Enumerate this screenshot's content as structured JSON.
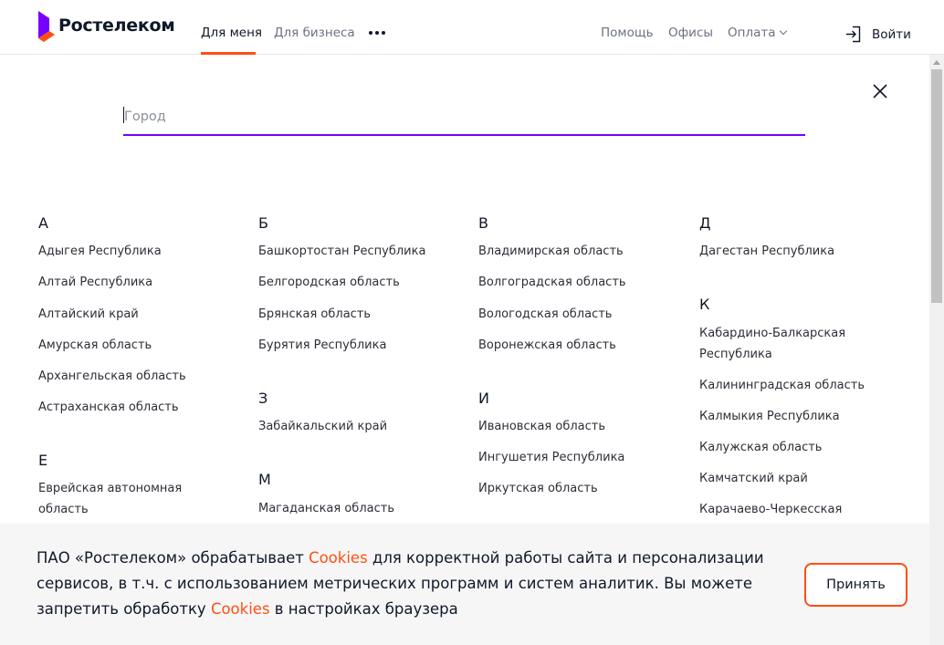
{
  "header": {
    "logo_text": "Ростелеком",
    "nav": [
      "Для меня",
      "Для бизнеса"
    ],
    "right_nav": [
      "Помощь",
      "Офисы",
      "Оплата"
    ],
    "login_label": "Войти",
    "accent": "#ff4f12",
    "logo_colors": [
      "#7700ff",
      "#ff4f12"
    ]
  },
  "search": {
    "placeholder": "Город",
    "value": ""
  },
  "regions": {
    "col1": {
      "A": {
        "letter": "А",
        "items": [
          "Адыгея Республика",
          "Алтай Республика",
          "Алтайский край",
          "Амурская область",
          "Архангельская область",
          "Астраханская область"
        ]
      },
      "E": {
        "letter": "Е",
        "items": [
          "Еврейская автономная",
          "область"
        ]
      }
    },
    "col2": {
      "B": {
        "letter": "Б",
        "items": [
          "Башкортостан Республика",
          "Белгородская область",
          "Брянская область",
          "Бурятия Республика"
        ]
      },
      "Z": {
        "letter": "З",
        "items": [
          "Забайкальский край"
        ]
      },
      "M": {
        "letter": "М",
        "items": [
          "Магаданская область"
        ]
      }
    },
    "col3": {
      "V": {
        "letter": "В",
        "items": [
          "Владимирская область",
          "Волгоградская область",
          "Вологодская область",
          "Воронежская область"
        ]
      },
      "I": {
        "letter": "И",
        "items": [
          "Ивановская область",
          "Ингушетия Республика",
          "Иркутская область"
        ]
      }
    },
    "col4": {
      "D": {
        "letter": "Д",
        "items": [
          "Дагестан Республика"
        ]
      },
      "K": {
        "letter": "К",
        "items": [
          "Кабардино-Балкарская",
          "Республика",
          "Калининградская область",
          "Калмыкия Республика",
          "Калужская область",
          "Камчатский край",
          "Карачаево-Черкесская"
        ]
      }
    }
  },
  "cookie": {
    "line1_a": "ПАО «Ростелеком» обрабатывает ",
    "link": "Cookies",
    "line1_b": " для корректной работы сайта и персонализации",
    "line2": "сервисов, в т.ч. с использованием метрических программ и систем аналитик. Вы можете",
    "line3_a": "запретить обработку ",
    "line3_b": " в настройках браузера",
    "accept_label": "Принять"
  }
}
